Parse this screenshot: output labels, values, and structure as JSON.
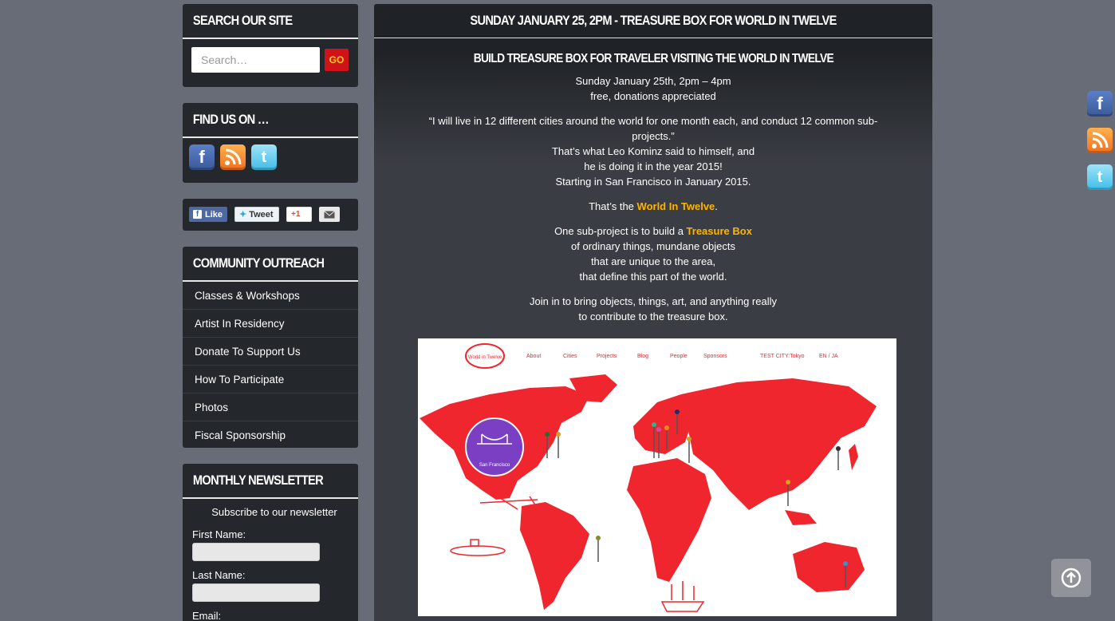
{
  "search": {
    "title": "SEARCH OUR SITE",
    "placeholder": "Search…",
    "go_label": "GO"
  },
  "find": {
    "title": "FIND US ON …",
    "icons": [
      "facebook-icon",
      "rss-icon",
      "twitter-icon"
    ]
  },
  "share": {
    "like": "Like",
    "tweet": "Tweet",
    "plus": "+1"
  },
  "outreach": {
    "title": "COMMUNITY OUTREACH",
    "items": [
      {
        "label": "Classes & Workshops"
      },
      {
        "label": "Artist In Residency"
      },
      {
        "label": "Donate To Support Us"
      },
      {
        "label": "How To Participate"
      },
      {
        "label": "Photos"
      },
      {
        "label": "Fiscal Sponsorship"
      }
    ]
  },
  "newsletter": {
    "title": "MONTHLY NEWSLETTER",
    "subtitle": "Subscribe to our newsletter",
    "first_name": "First Name:",
    "last_name": "Last Name:",
    "email": "Email:"
  },
  "post": {
    "page_title": "SUNDAY JANUARY 25, 2PM - TREASURE BOX FOR WORLD IN TWELVE",
    "heading": "BUILD TREASURE BOX FOR TRAVELER VISITING THE WORLD IN TWELVE",
    "date": "Sunday January 25th, 2pm – 4pm",
    "price": "free, donations appreciated",
    "quote_1": "“I will live in 12 different cities around the world for one month each, and conduct 12 common sub-projects.”",
    "quote_2": "That’s what Leo Kominz said to himself, and",
    "quote_3": "he is doing it in the year 2015!",
    "quote_4": "Starting in San Francisco in January 2015.",
    "thats_pre": "That’s the ",
    "thats_link": "World In Twelve",
    "thats_post": ".",
    "sub_pre": "One sub-project is to build a ",
    "sub_link": "Treasure Box",
    "sub_2": "of ordinary things, mundane objects",
    "sub_3": "that are unique to the area,",
    "sub_4": "that define this part of the world.",
    "join_1": "Join in to bring objects, things, art, and anything really",
    "join_2": "to contribute to the treasure box."
  },
  "map": {
    "logo": "World in Twelve",
    "nav": [
      "About",
      "Cities",
      "Projects",
      "Blog",
      "People",
      "Sponsors"
    ],
    "test_city": "TEST CITY:Tokyo",
    "lang": "EN / JA",
    "city_badge": "San Francisco",
    "colors": {
      "land": "#f0262e",
      "badge": "#7b3fc4"
    }
  },
  "colors": {
    "accent_link": "#ffb400",
    "go_button": "#d0121b",
    "background": "#676c77",
    "panel": "#24272c"
  }
}
